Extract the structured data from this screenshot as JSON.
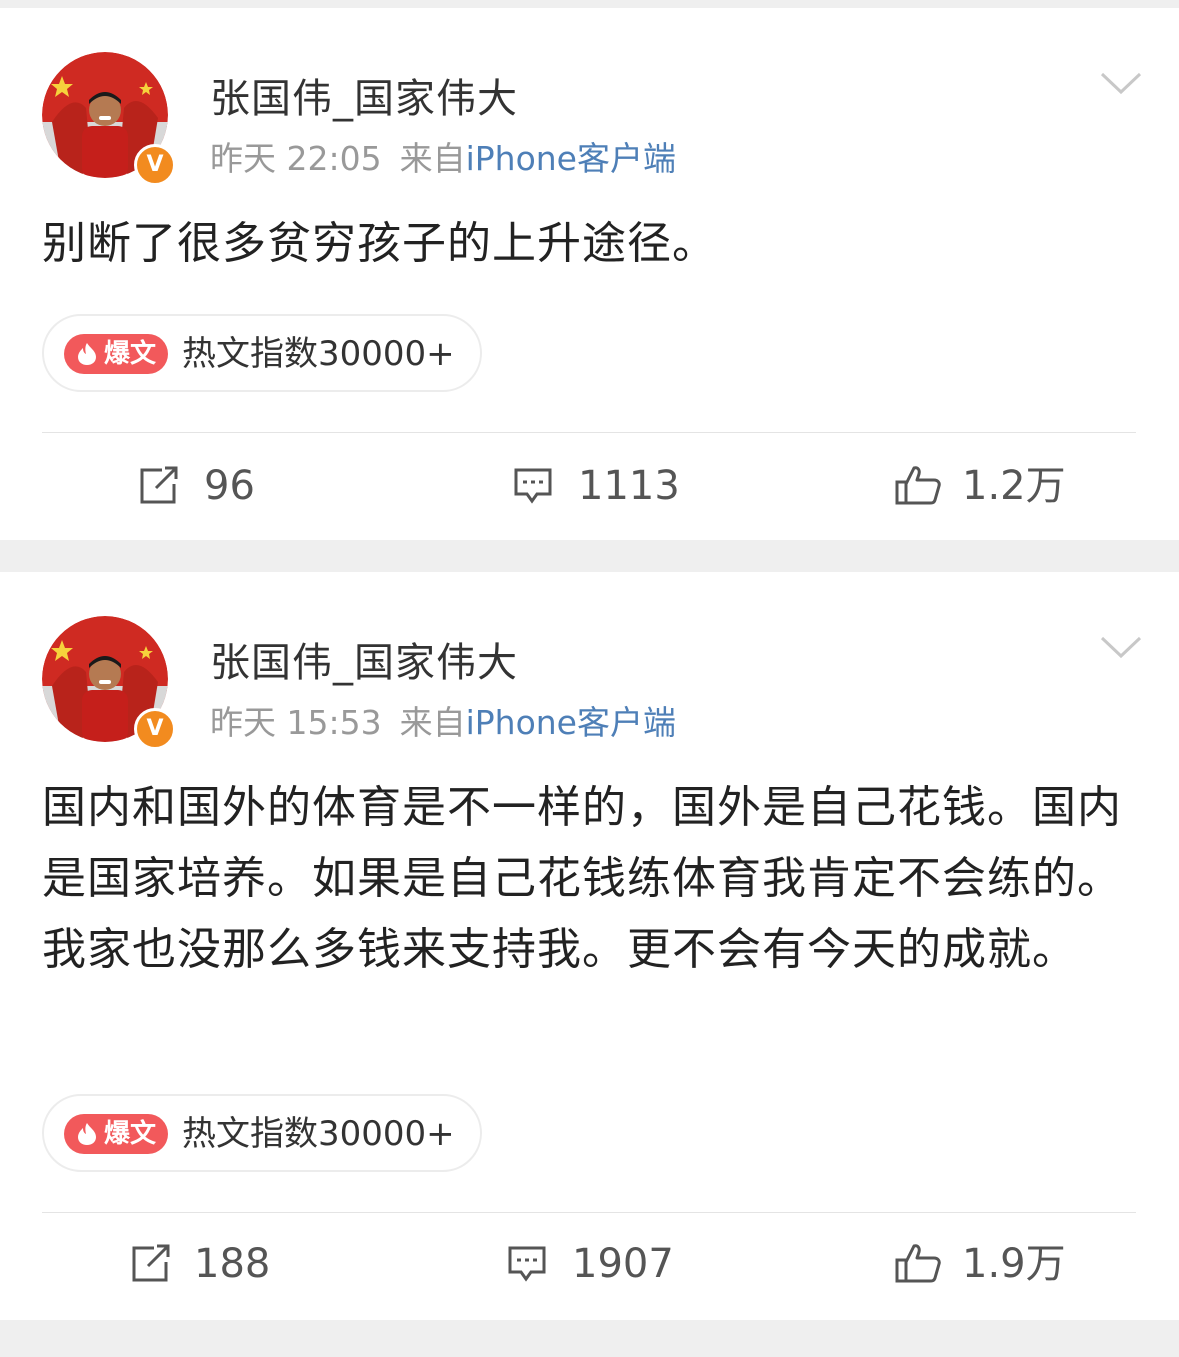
{
  "posts": [
    {
      "username": "张国伟_国家伟大",
      "verified_badge": "V",
      "time": "昨天 22:05",
      "source_prefix": "来自",
      "source_link": "iPhone客户端",
      "text": "别断了很多贫穷孩子的上升途径。",
      "hot": {
        "badge": "爆文",
        "text": "热文指数30000+"
      },
      "reposts": "96",
      "comments": "1113",
      "likes": "1.2万"
    },
    {
      "username": "张国伟_国家伟大",
      "verified_badge": "V",
      "time": "昨天 15:53",
      "source_prefix": "来自",
      "source_link": "iPhone客户端",
      "text": "国内和国外的体育是不一样的，国外是自己花钱。国内是国家培养。如果是自己花钱练体育我肯定不会练的。我家也没那么多钱来支持我。更不会有今天的成就。",
      "hot": {
        "badge": "爆文",
        "text": "热文指数30000+"
      },
      "reposts": "188",
      "comments": "1907",
      "likes": "1.9万"
    }
  ],
  "icons": {
    "repost": "repost-icon",
    "comment": "comment-icon",
    "like": "thumbs-up-icon",
    "menu": "chevron-down-icon",
    "flame": "flame-icon"
  },
  "colors": {
    "source_link": "#4e7fb7",
    "verified_badge": "#f28b1f",
    "hot_badge": "#f2595b",
    "separator": "#efefef"
  }
}
